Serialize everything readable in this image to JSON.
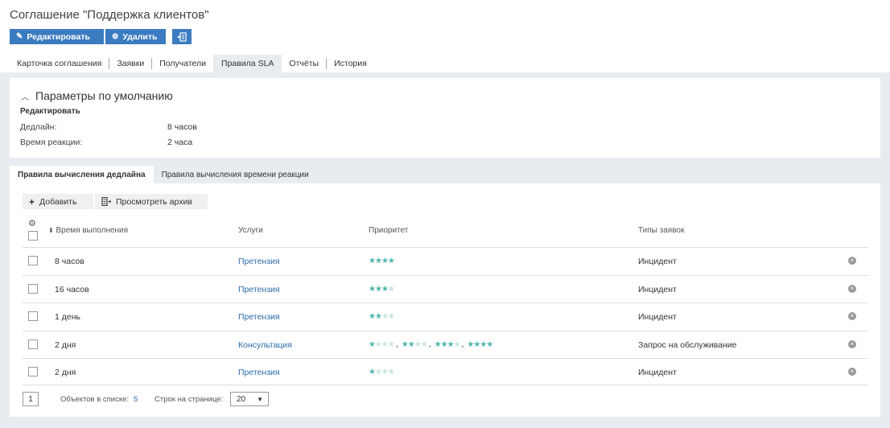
{
  "header": {
    "title": "Соглашение \"Поддержка клиентов\"",
    "edit_label": "Редактировать",
    "delete_label": "Удалить"
  },
  "tabs": [
    {
      "label": "Карточка соглашения"
    },
    {
      "label": "Заявки"
    },
    {
      "label": "Получатели"
    },
    {
      "label": "Правила SLA",
      "active": true
    },
    {
      "label": "Отчёты"
    },
    {
      "label": "История"
    }
  ],
  "defaults": {
    "title": "Параметры по умолчанию",
    "edit_label": "Редактировать",
    "deadline_label": "Дедлайн:",
    "deadline_value": "8 часов",
    "reaction_label": "Время реакции:",
    "reaction_value": "2 часа"
  },
  "subtabs": [
    {
      "label": "Правила вычисления дедлайна",
      "active": true
    },
    {
      "label": "Правила вычисления времени реакции"
    }
  ],
  "toolbar": {
    "add_label": "Добавить",
    "archive_label": "Просмотреть архив"
  },
  "table": {
    "columns": {
      "time": "Время выполнения",
      "service": "Услуги",
      "priority": "Приоритет",
      "types": "Типы заявок"
    },
    "rows": [
      {
        "time": "8 часов",
        "service": "Претензия",
        "priority": [
          4
        ],
        "type": "Инцидент"
      },
      {
        "time": "16 часов",
        "service": "Претензия",
        "priority": [
          3
        ],
        "type": "Инцидент"
      },
      {
        "time": "1 день",
        "service": "Претензия",
        "priority": [
          2
        ],
        "type": "Инцидент"
      },
      {
        "time": "2 дня",
        "service": "Консультация",
        "priority": [
          1,
          2,
          3,
          4
        ],
        "type": "Запрос на обслуживание"
      },
      {
        "time": "2 дня",
        "service": "Претензия",
        "priority": [
          1
        ],
        "type": "Инцидент"
      }
    ],
    "max_stars": 4
  },
  "pager": {
    "page": "1",
    "count_label": "Объектов в списке:",
    "count_value": "5",
    "rows_label": "Строк на странице:",
    "rows_value": "20"
  },
  "colors": {
    "primary": "#3b7bbf",
    "link": "#2a6aa8",
    "star_on": "#4db6ac",
    "star_off": "#c7e4e2",
    "background": "#e8ecf0"
  },
  "icons": {
    "edit": "pencil-icon",
    "delete": "close-circle-icon",
    "extra": "document-export-icon",
    "add": "plus-icon",
    "archive": "archive-icon",
    "settings": "gear-icon",
    "sort": "sort-icon",
    "remove": "remove-circle-icon",
    "collapse": "chevron-up-icon"
  }
}
